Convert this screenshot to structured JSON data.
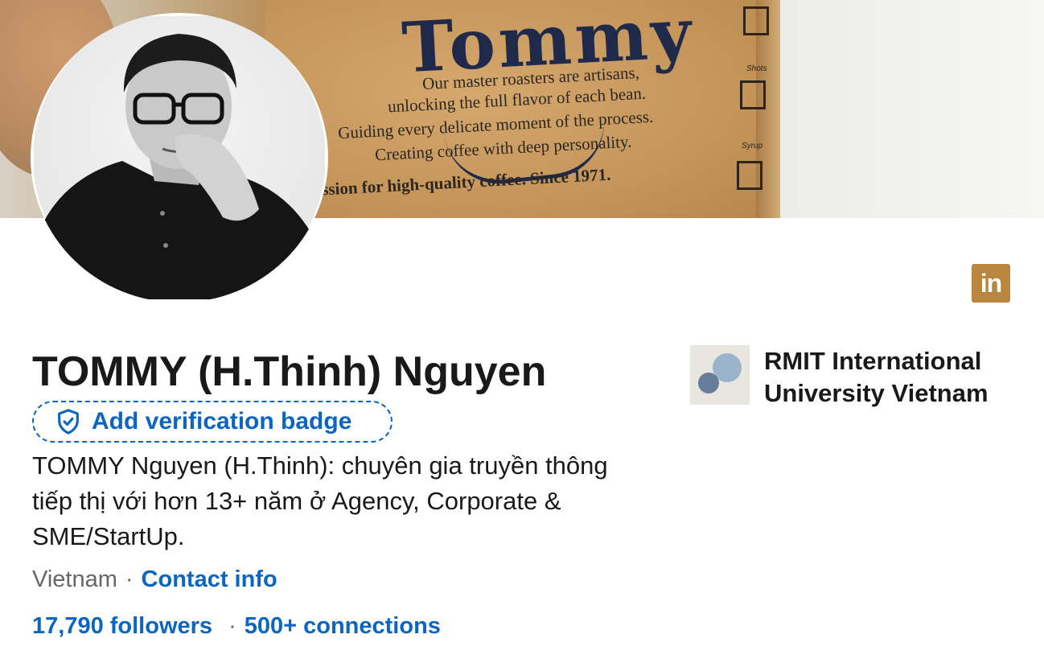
{
  "banner": {
    "cup_title": "Tommy",
    "cup_lines": [
      "Our master roasters are artisans,",
      "unlocking the full flavor of each bean.",
      "Guiding every delicate moment of the process.",
      "Creating coffee with deep personality.",
      "ssion for high-quality coffee. Since 1971."
    ],
    "cup_labels": [
      "Shots",
      "Syrup"
    ]
  },
  "profile": {
    "name": "TOMMY (H.Thinh) Nguyen",
    "verification_label": "Add verification badge",
    "headline": "TOMMY Nguyen (H.Thinh): chuyên gia truyền thông tiếp thị với hơn 13+ năm ở Agency, Corporate & SME/StartUp.",
    "location": "Vietnam",
    "separator": "·",
    "contact_info": "Contact info",
    "followers": "17,790 followers",
    "connections": "500+ connections"
  },
  "education": {
    "name_line1": "RMIT International",
    "name_line2": "University Vietnam"
  },
  "brand": {
    "linkedin_icon_text": "in",
    "accent_color": "#0a66c2",
    "linkedin_badge_color": "#b8863e"
  },
  "icons": {
    "shield": "shield-check-icon",
    "linkedin": "linkedin-icon",
    "school_logo": "school-logo-icon"
  }
}
